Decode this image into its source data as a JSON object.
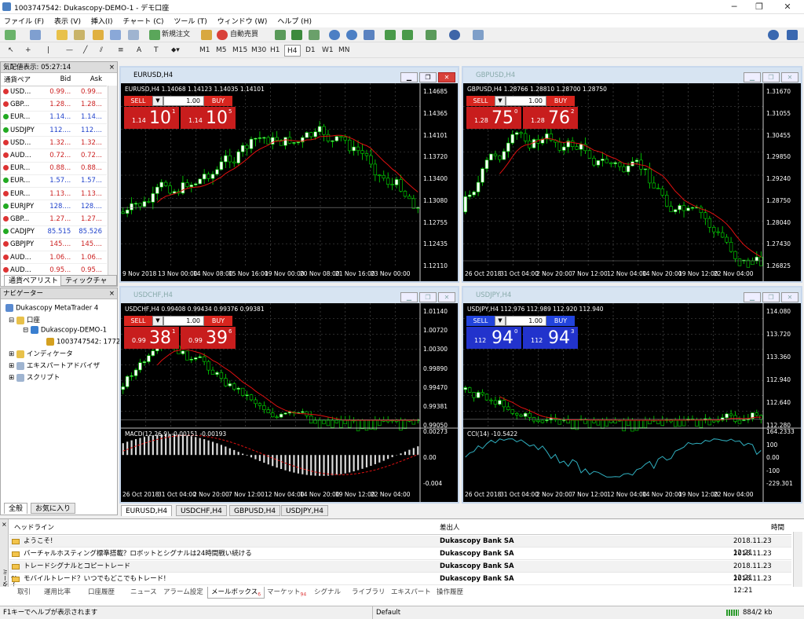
{
  "window": {
    "title": "1003747542: Dukascopy-DEMO-1 - デモ口座"
  },
  "menu": [
    "ファイル (F)",
    "表示 (V)",
    "挿入(I)",
    "チャート (C)",
    "ツール (T)",
    "ウィンドウ (W)",
    "ヘルプ (H)"
  ],
  "toolbar": {
    "new_order": "新規注文",
    "auto_trade": "自動売買",
    "timeframes": [
      "M1",
      "M5",
      "M15",
      "M30",
      "H1",
      "H4",
      "D1",
      "W1",
      "MN"
    ]
  },
  "market_watch": {
    "header": "気配値表示: 05:27:14",
    "cols": [
      "通貨ペア",
      "Bid",
      "Ask"
    ],
    "rows": [
      {
        "sym": "USD...",
        "bid": "0.99...",
        "ask": "0.99...",
        "dir": "dn",
        "color": "red"
      },
      {
        "sym": "GBP...",
        "bid": "1.28...",
        "ask": "1.28...",
        "dir": "dn",
        "color": "red"
      },
      {
        "sym": "EUR...",
        "bid": "1.14...",
        "ask": "1.14...",
        "dir": "up",
        "color": "blue"
      },
      {
        "sym": "USDJPY",
        "bid": "112....",
        "ask": "112....",
        "dir": "up",
        "color": "blue"
      },
      {
        "sym": "USD...",
        "bid": "1.32...",
        "ask": "1.32...",
        "dir": "dn",
        "color": "red"
      },
      {
        "sym": "AUD...",
        "bid": "0.72...",
        "ask": "0.72...",
        "dir": "dn",
        "color": "red"
      },
      {
        "sym": "EUR...",
        "bid": "0.88...",
        "ask": "0.88...",
        "dir": "dn",
        "color": "red"
      },
      {
        "sym": "EUR...",
        "bid": "1.57...",
        "ask": "1.57...",
        "dir": "up",
        "color": "blue"
      },
      {
        "sym": "EUR...",
        "bid": "1.13...",
        "ask": "1.13...",
        "dir": "dn",
        "color": "red"
      },
      {
        "sym": "EURJPY",
        "bid": "128....",
        "ask": "128....",
        "dir": "up",
        "color": "blue"
      },
      {
        "sym": "GBP...",
        "bid": "1.27...",
        "ask": "1.27...",
        "dir": "dn",
        "color": "red"
      },
      {
        "sym": "CADJPY",
        "bid": "85.515",
        "ask": "85.526",
        "dir": "up",
        "color": "blue"
      },
      {
        "sym": "GBPJPY",
        "bid": "145....",
        "ask": "145....",
        "dir": "dn",
        "color": "red"
      },
      {
        "sym": "AUD...",
        "bid": "1.06...",
        "ask": "1.06...",
        "dir": "dn",
        "color": "red"
      },
      {
        "sym": "AUD...",
        "bid": "0.95...",
        "ask": "0.95...",
        "dir": "dn",
        "color": "red"
      }
    ],
    "tabs": [
      "通貨ペアリスト",
      "ティックチャート"
    ]
  },
  "navigator": {
    "header": "ナビゲーター",
    "root": "Dukascopy MetaTrader 4",
    "account": "口座",
    "server": "Dukascopy-DEMO-1",
    "acct_id": "1003747542: 1772",
    "items": [
      "インディケータ",
      "エキスパートアドバイザ",
      "スクリプト"
    ],
    "tabs": [
      "全般",
      "お気に入り"
    ]
  },
  "charts": [
    {
      "title": "EURUSD,H4",
      "info": "EURUSD,H4  1.14068 1.14123 1.14035 1.14101",
      "lot": "1.00",
      "sell": {
        "small": "1.14",
        "big": "10",
        "sup": "1"
      },
      "buy": {
        "small": "1.14",
        "big": "10",
        "sup": "5"
      },
      "prices": [
        "1.14685",
        "1.14365",
        "1.14101",
        "1.13720",
        "1.13400",
        "1.13080",
        "1.12755",
        "1.12435",
        "1.12110"
      ],
      "times": [
        "9 Nov 2018",
        "13 Nov 00:00",
        "14 Nov 08:00",
        "15 Nov 16:00",
        "19 Nov 00:00",
        "20 Nov 08:00",
        "21 Nov 16:00",
        "23 Nov 00:00"
      ],
      "color": "red",
      "active": true
    },
    {
      "title": "GBPUSD,H4",
      "info": "GBPUSD,H4  1.28766 1.28810 1.28700 1.28750",
      "lot": "1.00",
      "sell": {
        "small": "1.28",
        "big": "75",
        "sup": "0"
      },
      "buy": {
        "small": "1.28",
        "big": "76",
        "sup": "2"
      },
      "prices": [
        "1.31670",
        "1.31055",
        "1.30455",
        "1.29850",
        "1.29240",
        "1.28750",
        "1.28040",
        "1.27430",
        "1.26825"
      ],
      "times": [
        "26 Oct 2018",
        "31 Oct 04:00",
        "2 Nov 20:00",
        "7 Nov 12:00",
        "12 Nov 04:00",
        "14 Nov 20:00",
        "19 Nov 12:00",
        "22 Nov 04:00"
      ],
      "color": "red",
      "active": false
    },
    {
      "title": "USDCHF,H4",
      "info": "USDCHF,H4  0.99408 0.99434 0.99376 0.99381",
      "lot": "1.00",
      "sell": {
        "small": "0.99",
        "big": "38",
        "sup": "1"
      },
      "buy": {
        "small": "0.99",
        "big": "39",
        "sup": "6"
      },
      "prices": [
        "1.01140",
        "1.00720",
        "1.00300",
        "0.99890",
        "0.99470",
        "0.99381",
        "0.99050"
      ],
      "times": [
        "26 Oct 2018",
        "31 Oct 04:00",
        "2 Nov 20:00",
        "7 Nov 12:00",
        "12 Nov 04:00",
        "14 Nov 20:00",
        "19 Nov 12:00",
        "22 Nov 04:00"
      ],
      "indicator": "MACD(12,26,9) -0.00151 -0.00193",
      "ind_axis": [
        "0.00273",
        "0.00",
        "-0.004"
      ],
      "color": "red",
      "active": false
    },
    {
      "title": "USDJPY,H4",
      "info": "USDJPY,H4  112.976 112.989 112.920 112.940",
      "lot": "1.00",
      "sell": {
        "small": "112",
        "big": "94",
        "sup": "0"
      },
      "buy": {
        "small": "112",
        "big": "94",
        "sup": "3"
      },
      "prices": [
        "114.080",
        "113.720",
        "113.360",
        "112.940",
        "112.640",
        "112.280"
      ],
      "times": [
        "26 Oct 2018",
        "31 Oct 04:00",
        "2 Nov 20:00",
        "7 Nov 12:00",
        "12 Nov 04:00",
        "14 Nov 20:00",
        "19 Nov 12:00",
        "22 Nov 04:00"
      ],
      "indicator": "CCI(14) -10.5422",
      "ind_axis": [
        "164.2333",
        "100",
        "0.00",
        "-100",
        "-229.301"
      ],
      "color": "blue",
      "active": false
    }
  ],
  "chart_tabs": [
    "EURUSD,H4",
    "USDCHF,H4",
    "GBPUSD,H4",
    "USDJPY,H4"
  ],
  "terminal": {
    "side_label": "ターミナル",
    "cols": [
      "ヘッドライン",
      "差出人",
      "時間"
    ],
    "rows": [
      {
        "h": "ようこそ!",
        "from": "Dukascopy Bank SA",
        "time": "2018.11.23 12:21"
      },
      {
        "h": "バーチャルホスティング標準搭載？ロボットとシグナルは24時間戦い続ける",
        "from": "Dukascopy Bank SA",
        "time": "2018.11.23 12:21"
      },
      {
        "h": "トレードシグナルとコピートレード",
        "from": "Dukascopy Bank SA",
        "time": "2018.11.23 12:21"
      },
      {
        "h": "モバイルトレード？いつでもどこでもトレード!",
        "from": "Dukascopy Bank SA",
        "time": "2018.11.23 12:21"
      }
    ],
    "tabs": [
      "取引",
      "運用比率",
      "口座履歴",
      "ニュース",
      "アラーム設定",
      "メールボックス",
      "マーケット",
      "シグナル",
      "ライブラリ",
      "エキスパート",
      "操作履歴"
    ],
    "mail_badge": "6",
    "market_badge": "94"
  },
  "status": {
    "help": "F1キーでヘルプが表示されます",
    "profile": "Default",
    "traffic": "884/2 kb"
  }
}
